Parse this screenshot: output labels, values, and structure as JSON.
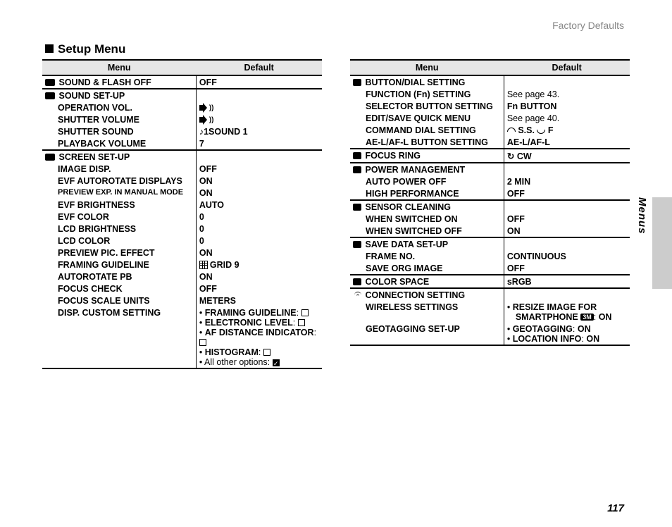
{
  "header": {
    "topRight": "Factory Defaults"
  },
  "sideLabel": "Menus",
  "sectionTitle": "Setup Menu",
  "pageNumber": "117",
  "tableHeaders": {
    "menu": "Menu",
    "default": "Default"
  },
  "left": {
    "g1": {
      "title": "SOUND & FLASH OFF",
      "val": "OFF"
    },
    "g2": {
      "title": "SOUND SET-UP",
      "r1": {
        "m": "OPERATION VOL."
      },
      "r2": {
        "m": "SHUTTER VOLUME"
      },
      "r3": {
        "m": "SHUTTER SOUND",
        "v": "1SOUND 1"
      },
      "r4": {
        "m": "PLAYBACK VOLUME",
        "v": "7"
      }
    },
    "g3": {
      "title": "SCREEN SET-UP",
      "r1": {
        "m": "IMAGE DISP.",
        "v": "OFF"
      },
      "r2": {
        "m": "EVF AUTOROTATE DISPLAYS",
        "v": "ON"
      },
      "r3": {
        "m": "PREVIEW EXP. IN MANUAL MODE",
        "v": "ON"
      },
      "r4": {
        "m": "EVF BRIGHTNESS",
        "v": "AUTO"
      },
      "r5": {
        "m": "EVF COLOR",
        "v": "0"
      },
      "r6": {
        "m": "LCD BRIGHTNESS",
        "v": "0"
      },
      "r7": {
        "m": "LCD COLOR",
        "v": "0"
      },
      "r8": {
        "m": "PREVIEW PIC. EFFECT",
        "v": "ON"
      },
      "r9": {
        "m": "FRAMING GUIDELINE",
        "v": "GRID 9"
      },
      "r10": {
        "m": "AUTOROTATE PB",
        "v": "ON"
      },
      "r11": {
        "m": "FOCUS CHECK",
        "v": "OFF"
      },
      "r12": {
        "m": "FOCUS SCALE UNITS",
        "v": "METERS"
      },
      "r13": {
        "m": "DISP. CUSTOM SETTING",
        "b1": "FRAMING GUIDELINE",
        "b2": "ELECTRONIC LEVEL",
        "b3": "AF DISTANCE INDICATOR",
        "b4": "HISTOGRAM",
        "b5": "All other options:"
      }
    }
  },
  "right": {
    "g1": {
      "title": "BUTTON/DIAL SETTING",
      "r1": {
        "m": "FUNCTION (Fn) SETTING",
        "v": "See page 43."
      },
      "r2": {
        "m": "SELECTOR BUTTON SETTING",
        "v": "Fn BUTTON"
      },
      "r3": {
        "m": "EDIT/SAVE QUICK MENU",
        "v": "See page 40."
      },
      "r4": {
        "m": "COMMAND DIAL SETTING",
        "va": "S.S.",
        "vb": "F"
      },
      "r5": {
        "m": "AE-L/AF-L BUTTON SETTING",
        "v": "AE-L/AF-L"
      }
    },
    "g2": {
      "title": "FOCUS RING",
      "v": "CW"
    },
    "g3": {
      "title": "POWER MANAGEMENT",
      "r1": {
        "m": "AUTO POWER OFF",
        "v": "2 MIN"
      },
      "r2": {
        "m": "HIGH PERFORMANCE",
        "v": "OFF"
      }
    },
    "g4": {
      "title": "SENSOR CLEANING",
      "r1": {
        "m": "WHEN SWITCHED ON",
        "v": "OFF"
      },
      "r2": {
        "m": "WHEN SWITCHED OFF",
        "v": "ON"
      }
    },
    "g5": {
      "title": "SAVE DATA SET-UP",
      "r1": {
        "m": "FRAME NO.",
        "v": "CONTINUOUS"
      },
      "r2": {
        "m": "SAVE ORG IMAGE",
        "v": "OFF"
      }
    },
    "g6": {
      "title": "COLOR SPACE",
      "v": "sRGB"
    },
    "g7": {
      "title": "CONNECTION SETTING",
      "r1": {
        "m": "WIRELESS SETTINGS",
        "b1a": "RESIZE IMAGE FOR",
        "b1b": "SMARTPHONE",
        "b1c": "ON"
      },
      "r2": {
        "m": "GEOTAGGING SET-UP",
        "b1": "GEOTAGGING",
        "b1v": "ON",
        "b2": "LOCATION INFO",
        "b2v": "ON"
      }
    }
  }
}
